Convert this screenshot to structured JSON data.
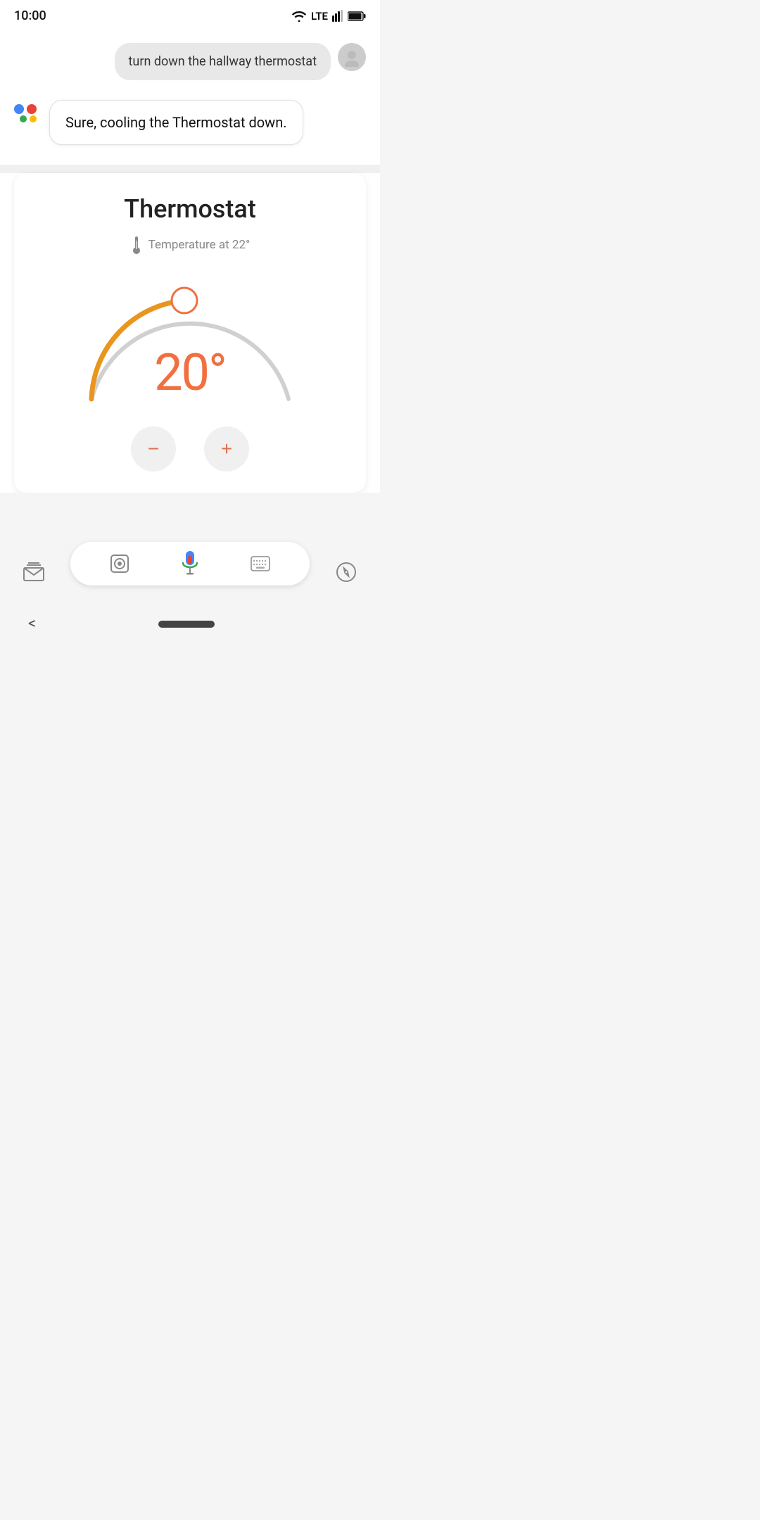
{
  "statusBar": {
    "time": "10:00",
    "wifi": true,
    "lte": "LTE",
    "signal": true,
    "battery": true
  },
  "userMessage": {
    "text": "turn down the hallway thermostat"
  },
  "assistantMessage": {
    "text": "Sure, cooling the Thermostat down."
  },
  "thermostat": {
    "title": "Thermostat",
    "tempLabel": "Temperature at 22°",
    "currentTemp": "20°",
    "decreaseLabel": "−",
    "increaseLabel": "+",
    "arcColor": "#E8961E",
    "arcTrackColor": "#ccc",
    "knobColor": "#F07040"
  },
  "inputBar": {
    "lensIcon": "lens-icon",
    "micIcon": "mic-icon",
    "keyboardIcon": "keyboard-icon"
  },
  "navBar": {
    "backLabel": "<",
    "homeIndicator": ""
  },
  "icons": {
    "assistantDots": [
      "#4285F4",
      "#EA4335",
      "#34A853",
      "#FBBC04"
    ],
    "inboxIcon": "inbox-icon",
    "compassIcon": "compass-icon"
  }
}
